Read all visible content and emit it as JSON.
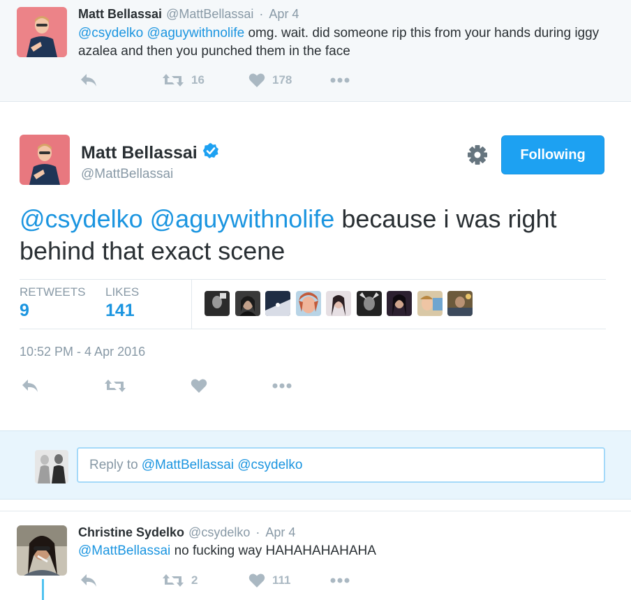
{
  "colors": {
    "accent": "#1da1f2",
    "link": "#1b95e0",
    "muted": "#8899a6",
    "text": "#292f33"
  },
  "parent_tweet": {
    "name": "Matt Bellassai",
    "handle": "@MattBellassai",
    "separator": "·",
    "date": "Apr 4",
    "mention1": "@csydelko",
    "mention2": "@aguywithnolife",
    "text": "omg. wait. did someone rip this from your hands during iggy azalea and then you punched them in the face",
    "retweets": "16",
    "likes": "178"
  },
  "focused_tweet": {
    "name": "Matt Bellassai",
    "handle": "@MattBellassai",
    "follow_label": "Following",
    "mention1": "@csydelko",
    "mention2": "@aguywithnolife",
    "text": "because i was right behind that exact scene",
    "stats": {
      "retweets_label": "RETWEETS",
      "retweets": "9",
      "likes_label": "LIKES",
      "likes": "141"
    },
    "liker_count": 9,
    "timestamp": "10:52 PM - 4 Apr 2016"
  },
  "reply_box": {
    "prefix": "Reply to",
    "mentions": "@MattBellassai @csydelko"
  },
  "child_tweet": {
    "name": "Christine Sydelko",
    "handle": "@csydelko",
    "separator": "·",
    "date": "Apr 4",
    "mention": "@MattBellassai",
    "text": "no fucking way HAHAHAHAHAHA",
    "retweets": "2",
    "likes": "111"
  },
  "icons": [
    "reply-icon",
    "retweet-icon",
    "heart-icon",
    "more-icon",
    "gear-icon",
    "verified-icon"
  ]
}
